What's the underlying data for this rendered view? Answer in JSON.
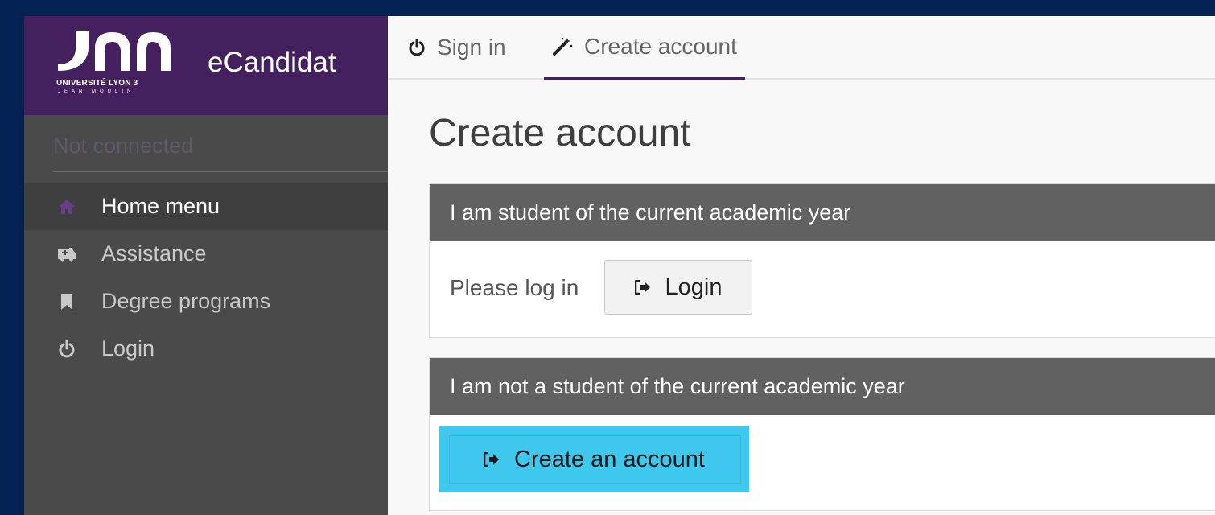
{
  "brand": {
    "logo_line1": "UNIVERSITÉ LYON 3",
    "logo_line2": "JEAN MOULIN",
    "app_name": "eCandidat",
    "brand_color": "#44205f"
  },
  "sidebar": {
    "status": "Not connected",
    "items": [
      {
        "label": "Home menu",
        "icon": "home-icon",
        "active": true
      },
      {
        "label": "Assistance",
        "icon": "ambulance-icon",
        "active": false
      },
      {
        "label": "Degree programs",
        "icon": "bookmark-icon",
        "active": false
      },
      {
        "label": "Login",
        "icon": "power-icon",
        "active": false
      }
    ]
  },
  "tabs": [
    {
      "label": "Sign in",
      "icon": "power-icon",
      "active": false
    },
    {
      "label": "Create account",
      "icon": "magic-wand-icon",
      "active": true
    }
  ],
  "main": {
    "title": "Create account",
    "panel_student": {
      "header": "I am student of the current academic year",
      "prompt": "Please log in",
      "button": "Login"
    },
    "panel_not_student": {
      "header": "I am not a student of the current academic year",
      "button": "Create an account",
      "button_color": "#3fc8ed"
    }
  }
}
